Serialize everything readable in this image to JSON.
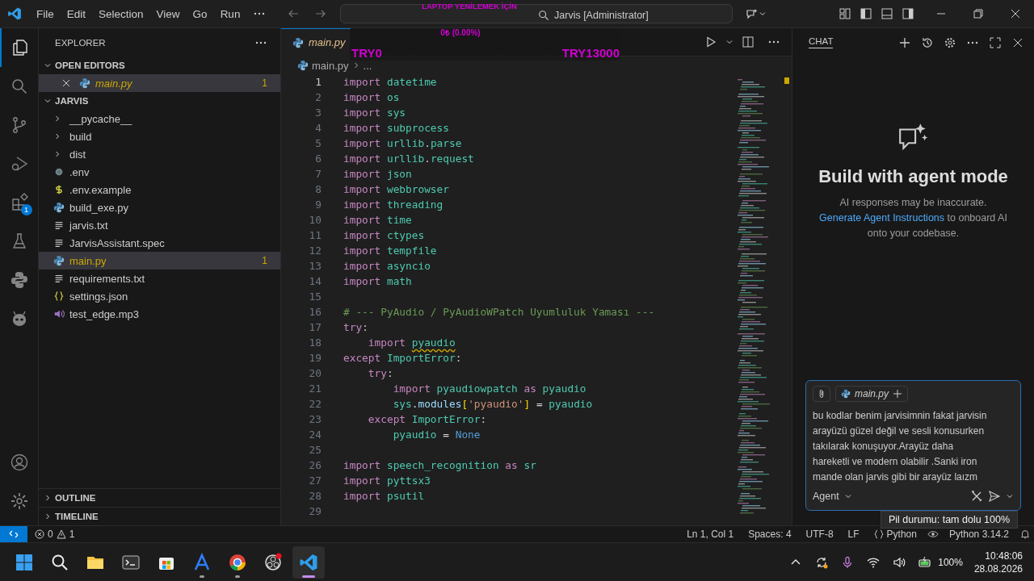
{
  "title_bar": {
    "menu": [
      "File",
      "Edit",
      "Selection",
      "View",
      "Go",
      "Run"
    ],
    "search": "Jarvis [Administrator]"
  },
  "overlay": {
    "heading": "LAPTOP YENİLEMEK İÇİN",
    "amount": "0₺ (0.00%)",
    "start": "TRY0",
    "goal": "TRY13000"
  },
  "activity_bar": {
    "extensions_badge": "1"
  },
  "sidebar": {
    "title": "EXPLORER",
    "open_editors": {
      "title": "OPEN EDITORS",
      "expanded": true,
      "items": [
        {
          "name": "main.py",
          "kind": "python",
          "badge": "1",
          "selected": true
        }
      ]
    },
    "folder": {
      "title": "JARVIS",
      "expanded": true,
      "items": [
        {
          "name": "__pycache__",
          "kind": "folder",
          "expanded": false,
          "selected": false
        },
        {
          "name": "build",
          "kind": "folder",
          "expanded": false,
          "selected": false
        },
        {
          "name": "dist",
          "kind": "folder",
          "expanded": false,
          "selected": false
        },
        {
          "name": ".env",
          "kind": "gear",
          "selected": false
        },
        {
          "name": ".env.example",
          "kind": "dollar",
          "selected": false
        },
        {
          "name": "build_exe.py",
          "kind": "python",
          "selected": false
        },
        {
          "name": "jarvis.txt",
          "kind": "text",
          "selected": false
        },
        {
          "name": "JarvisAssistant.spec",
          "kind": "text",
          "selected": false
        },
        {
          "name": "main.py",
          "kind": "python",
          "badge": "1",
          "selected": true
        },
        {
          "name": "requirements.txt",
          "kind": "text",
          "selected": false
        },
        {
          "name": "settings.json",
          "kind": "json",
          "selected": false
        },
        {
          "name": "test_edge.mp3",
          "kind": "audio",
          "selected": false
        }
      ]
    },
    "sections": [
      {
        "title": "OUTLINE",
        "expanded": false
      },
      {
        "title": "TIMELINE",
        "expanded": false
      }
    ]
  },
  "editor": {
    "tab": "main.py",
    "breadcrumb": [
      "main.py",
      "..."
    ],
    "lines": [
      {
        "number": "1",
        "current": true,
        "tokens": [
          {
            "kind": "kw",
            "text": "import"
          },
          {
            "kind": "mod",
            "text": " datetime"
          }
        ]
      },
      {
        "number": "2",
        "current": false,
        "tokens": [
          {
            "kind": "kw",
            "text": "import"
          },
          {
            "kind": "mod",
            "text": " os"
          }
        ]
      },
      {
        "number": "3",
        "current": false,
        "tokens": [
          {
            "kind": "kw",
            "text": "import"
          },
          {
            "kind": "mod",
            "text": " sys"
          }
        ]
      },
      {
        "number": "4",
        "current": false,
        "tokens": [
          {
            "kind": "kw",
            "text": "import"
          },
          {
            "kind": "mod",
            "text": " subprocess"
          }
        ]
      },
      {
        "number": "5",
        "current": false,
        "tokens": [
          {
            "kind": "kw",
            "text": "import"
          },
          {
            "kind": "mod",
            "text": " urllib"
          },
          {
            "kind": "plain",
            "text": "."
          },
          {
            "kind": "mod",
            "text": "parse"
          }
        ]
      },
      {
        "number": "6",
        "current": false,
        "tokens": [
          {
            "kind": "kw",
            "text": "import"
          },
          {
            "kind": "mod",
            "text": " urllib"
          },
          {
            "kind": "plain",
            "text": "."
          },
          {
            "kind": "mod",
            "text": "request"
          }
        ]
      },
      {
        "number": "7",
        "current": false,
        "tokens": [
          {
            "kind": "kw",
            "text": "import"
          },
          {
            "kind": "mod",
            "text": " json"
          }
        ]
      },
      {
        "number": "8",
        "current": false,
        "tokens": [
          {
            "kind": "kw",
            "text": "import"
          },
          {
            "kind": "mod",
            "text": " webbrowser"
          }
        ]
      },
      {
        "number": "9",
        "current": false,
        "tokens": [
          {
            "kind": "kw",
            "text": "import"
          },
          {
            "kind": "mod",
            "text": " threading"
          }
        ]
      },
      {
        "number": "10",
        "current": false,
        "tokens": [
          {
            "kind": "kw",
            "text": "import"
          },
          {
            "kind": "mod",
            "text": " time"
          }
        ]
      },
      {
        "number": "11",
        "current": false,
        "tokens": [
          {
            "kind": "kw",
            "text": "import"
          },
          {
            "kind": "mod",
            "text": " ctypes"
          }
        ]
      },
      {
        "number": "12",
        "current": false,
        "tokens": [
          {
            "kind": "kw",
            "text": "import"
          },
          {
            "kind": "mod",
            "text": " tempfile"
          }
        ]
      },
      {
        "number": "13",
        "current": false,
        "tokens": [
          {
            "kind": "kw",
            "text": "import"
          },
          {
            "kind": "mod",
            "text": " asyncio"
          }
        ]
      },
      {
        "number": "14",
        "current": false,
        "tokens": [
          {
            "kind": "kw",
            "text": "import"
          },
          {
            "kind": "mod",
            "text": " math"
          }
        ]
      },
      {
        "number": "15",
        "current": false
      },
      {
        "number": "16",
        "current": false,
        "tokens": [
          {
            "kind": "comment",
            "text": "# --- PyAudio / PyAudioWPatch Uyumluluk Yaması ---"
          }
        ]
      },
      {
        "number": "17",
        "current": false,
        "tokens": [
          {
            "kind": "kw",
            "text": "try"
          },
          {
            "kind": "plain",
            "text": ":"
          }
        ]
      },
      {
        "number": "18",
        "current": false,
        "tokens": [
          {
            "kind": "kw",
            "text": "    import "
          },
          {
            "kind": "warn",
            "text": "pyaudio"
          }
        ]
      },
      {
        "number": "19",
        "current": false,
        "tokens": [
          {
            "kind": "kw",
            "text": "except"
          },
          {
            "kind": "mod",
            "text": " ImportError"
          },
          {
            "kind": "plain",
            "text": ":"
          }
        ]
      },
      {
        "number": "20",
        "current": false,
        "tokens": [
          {
            "kind": "kw",
            "text": "    try"
          },
          {
            "kind": "plain",
            "text": ":"
          }
        ]
      },
      {
        "number": "21",
        "current": false,
        "tokens": [
          {
            "kind": "kw",
            "text": "        import"
          },
          {
            "kind": "mod",
            "text": " pyaudiowpatch"
          },
          {
            "kind": "kw",
            "text": " as"
          },
          {
            "kind": "mod",
            "text": " pyaudio"
          }
        ]
      },
      {
        "number": "22",
        "current": false,
        "tokens": [
          {
            "kind": "mod",
            "text": "        sys"
          },
          {
            "kind": "plain",
            "text": "."
          },
          {
            "kind": "prop",
            "text": "modules"
          },
          {
            "kind": "bracket",
            "text": "["
          },
          {
            "kind": "str",
            "text": "'pyaudio'"
          },
          {
            "kind": "bracket",
            "text": "]"
          },
          {
            "kind": "plain",
            "text": " = "
          },
          {
            "kind": "mod",
            "text": "pyaudio"
          }
        ]
      },
      {
        "number": "23",
        "current": false,
        "tokens": [
          {
            "kind": "kw",
            "text": "    except"
          },
          {
            "kind": "mod",
            "text": " ImportError"
          },
          {
            "kind": "plain",
            "text": ":"
          }
        ]
      },
      {
        "number": "24",
        "current": false,
        "tokens": [
          {
            "kind": "mod",
            "text": "        pyaudio"
          },
          {
            "kind": "plain",
            "text": " = "
          },
          {
            "kind": "const",
            "text": "None"
          }
        ]
      },
      {
        "number": "25",
        "current": false
      },
      {
        "number": "26",
        "current": false,
        "tokens": [
          {
            "kind": "kw",
            "text": "import"
          },
          {
            "kind": "mod",
            "text": " speech_recognition"
          },
          {
            "kind": "kw",
            "text": " as"
          },
          {
            "kind": "mod",
            "text": " sr"
          }
        ]
      },
      {
        "number": "27",
        "current": false,
        "tokens": [
          {
            "kind": "kw",
            "text": "import"
          },
          {
            "kind": "mod",
            "text": " pyttsx3"
          }
        ]
      },
      {
        "number": "28",
        "current": false,
        "tokens": [
          {
            "kind": "kw",
            "text": "import"
          },
          {
            "kind": "mod",
            "text": " psutil"
          }
        ]
      },
      {
        "number": "29",
        "current": false
      }
    ]
  },
  "chat": {
    "title": "CHAT",
    "heading": "Build with agent mode",
    "disclaimer": "AI responses may be inaccurate.",
    "hint_link": "Generate Agent Instructions",
    "hint_text": "to onboard AI onto your codebase.",
    "input": {
      "attachment": "main.py",
      "value": "bu kodlar benim jarvisimnin fakat jarvisin arayüzü güzel değil ve sesli konusurken takılarak konuşuyor.Arayüz daha hareketli ve modern olabilir .Sanki iron mande olan jarvis gibi bir arayüz laızm",
      "mode": "Agent"
    }
  },
  "status_bar": {
    "errors": "0",
    "warnings": "1",
    "items": [
      "Ln 1, Col 1",
      "Spaces: 4",
      "UTF-8",
      "LF"
    ],
    "language": "Python",
    "interpreter": "Python 3.14.2"
  },
  "tooltip": "Pil durumu: tam dolu 100%",
  "taskbar": {
    "apps": [
      {
        "kind": "start",
        "running": false,
        "selected": false
      },
      {
        "kind": "search",
        "running": false,
        "selected": false
      },
      {
        "kind": "files",
        "running": false,
        "selected": false
      },
      {
        "kind": "terminal",
        "running": false,
        "selected": false
      },
      {
        "kind": "store",
        "running": false,
        "selected": false
      },
      {
        "kind": "letter",
        "running": true,
        "selected": false
      },
      {
        "kind": "browser",
        "running": true,
        "selected": false
      },
      {
        "kind": "recorder",
        "running": false,
        "selected": false
      },
      {
        "kind": "code",
        "running": true,
        "selected": true
      }
    ],
    "battery": "100%",
    "time": "10:48:06",
    "date": "28.08.2026"
  }
}
